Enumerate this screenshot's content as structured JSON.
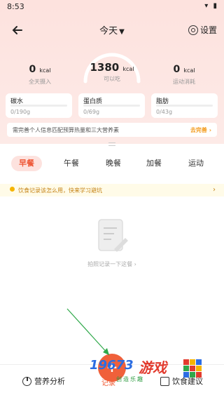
{
  "status": {
    "time": "8:53"
  },
  "header": {
    "title": "今天",
    "settings_label": "设置"
  },
  "summary": {
    "remaining_value": "1380",
    "remaining_unit": "kcal",
    "remaining_label": "可以吃",
    "intake_value": "0",
    "intake_unit": "kcal",
    "intake_label": "全天摄入",
    "burn_value": "0",
    "burn_unit": "kcal",
    "burn_label": "运动消耗"
  },
  "macros": [
    {
      "name": "碳水",
      "amount": "0/190g",
      "progress": 0
    },
    {
      "name": "蛋白质",
      "amount": "0/69g",
      "progress": 0
    },
    {
      "name": "脂肪",
      "amount": "0/43g",
      "progress": 0
    }
  ],
  "info_banner": {
    "text": "需完善个人信息匹配预算热量和三大营养素",
    "action": "去完善"
  },
  "meal_tabs": [
    "早餐",
    "午餐",
    "晚餐",
    "加餐",
    "运动"
  ],
  "active_tab": "早餐",
  "tip": {
    "text": "饮食记录该怎么用，快来学习避坑"
  },
  "empty_state": {
    "text": "拍照记录一下这餐 ›"
  },
  "bottom_nav": {
    "left_label": "营养分析",
    "center_label": "记录",
    "right_label": "饮食建议"
  },
  "watermark": {
    "number": "19673",
    "cn": "游戏",
    "sub": "创造乐趣"
  },
  "colors": {
    "accent": "#f0603a",
    "tab_active_bg": "#fde2de",
    "tip_text": "#c58316",
    "banner_action": "#f39b1c"
  }
}
